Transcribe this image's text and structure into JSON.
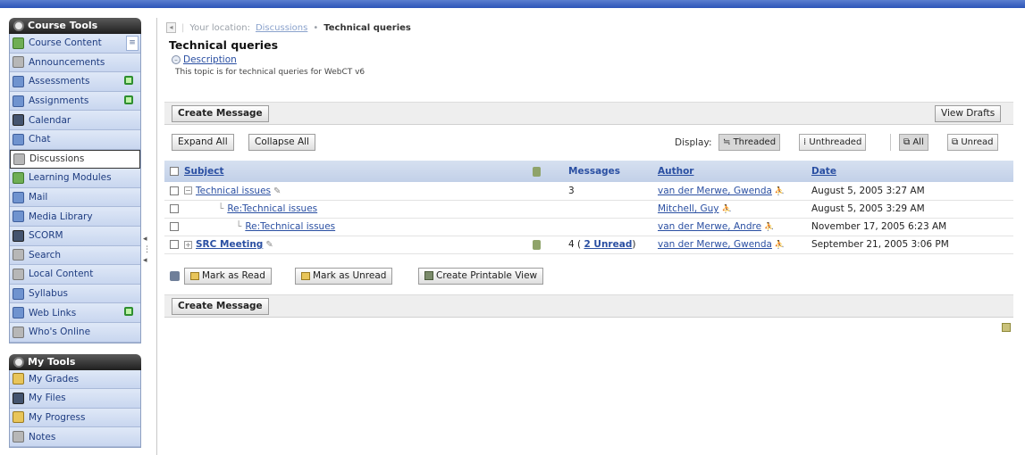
{
  "sidebar": {
    "course_tools": {
      "title": "Course Tools",
      "items": [
        {
          "label": "Course Content",
          "icon": "course-content-icon"
        },
        {
          "label": "Announcements",
          "icon": "announcements-icon"
        },
        {
          "label": "Assessments",
          "icon": "assessments-icon"
        },
        {
          "label": "Assignments",
          "icon": "assignments-icon"
        },
        {
          "label": "Calendar",
          "icon": "calendar-icon"
        },
        {
          "label": "Chat",
          "icon": "chat-icon"
        },
        {
          "label": "Discussions",
          "icon": "discussions-icon"
        },
        {
          "label": "Learning Modules",
          "icon": "learning-modules-icon"
        },
        {
          "label": "Mail",
          "icon": "mail-icon"
        },
        {
          "label": "Media Library",
          "icon": "media-library-icon"
        },
        {
          "label": "SCORM",
          "icon": "scorm-icon"
        },
        {
          "label": "Search",
          "icon": "search-icon"
        },
        {
          "label": "Local Content",
          "icon": "local-content-icon"
        },
        {
          "label": "Syllabus",
          "icon": "syllabus-icon"
        },
        {
          "label": "Web Links",
          "icon": "web-links-icon"
        },
        {
          "label": "Who's Online",
          "icon": "whos-online-icon"
        }
      ]
    },
    "my_tools": {
      "title": "My Tools",
      "items": [
        {
          "label": "My Grades",
          "icon": "grades-icon"
        },
        {
          "label": "My Files",
          "icon": "files-icon"
        },
        {
          "label": "My Progress",
          "icon": "progress-icon"
        },
        {
          "label": "Notes",
          "icon": "notes-icon"
        }
      ]
    }
  },
  "location": {
    "prefix": "Your location:",
    "link": "Discussions",
    "separator": "•",
    "current": "Technical queries"
  },
  "page": {
    "title": "Technical queries",
    "description_link": "Description",
    "description_text": "This topic is for technical queries for WebCT v6"
  },
  "actions": {
    "create_message": "Create Message",
    "view_drafts": "View Drafts",
    "expand_all": "Expand All",
    "collapse_all": "Collapse All",
    "display_label": "Display:",
    "threaded": "Threaded",
    "unthreaded": "Unthreaded",
    "all": "All",
    "unread": "Unread",
    "mark_read": "Mark as Read",
    "mark_unread": "Mark as Unread",
    "printable": "Create Printable View"
  },
  "table": {
    "headers": {
      "subject": "Subject",
      "messages": "Messages",
      "author": "Author",
      "date": "Date"
    },
    "rows": [
      {
        "subject": "Technical issues",
        "messages": "3",
        "author": "van der Merwe, Gwenda",
        "date": "August 5, 2005 3:27 AM"
      },
      {
        "subject": "Re:Technical issues",
        "messages": "",
        "author": "Mitchell, Guy",
        "date": "August 5, 2005 3:29 AM"
      },
      {
        "subject": "Re:Technical issues",
        "messages": "",
        "author": "van der Merwe, Andre",
        "date": "November 17, 2005 6:23 AM"
      },
      {
        "subject": "SRC Meeting",
        "messages": "4 (",
        "unread_link": "2 Unread",
        "messages_close": ")",
        "author": "van der Merwe, Gwenda",
        "date": "September 21, 2005 3:06 PM"
      }
    ]
  }
}
